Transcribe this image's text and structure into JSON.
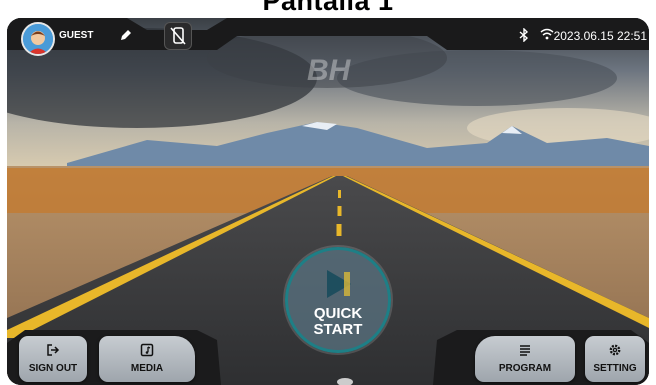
{
  "page_title": "Pantalla 1",
  "watermark": "BH",
  "header": {
    "user_name": "GUEST",
    "datetime": "2023.06.15 22:51"
  },
  "quick_start": {
    "label_line1": "QUICK",
    "label_line2": "START"
  },
  "footer": {
    "sign_out": "SIGN OUT",
    "media": "MEDIA",
    "program": "PROGRAM",
    "setting": "SETTING"
  },
  "icons": [
    "avatar",
    "edit-pencil-icon",
    "no-phone-icon",
    "bluetooth-icon",
    "wifi-icon",
    "sign-out-icon",
    "media-icon",
    "program-icon",
    "setting-gear-icon",
    "play-icon"
  ]
}
